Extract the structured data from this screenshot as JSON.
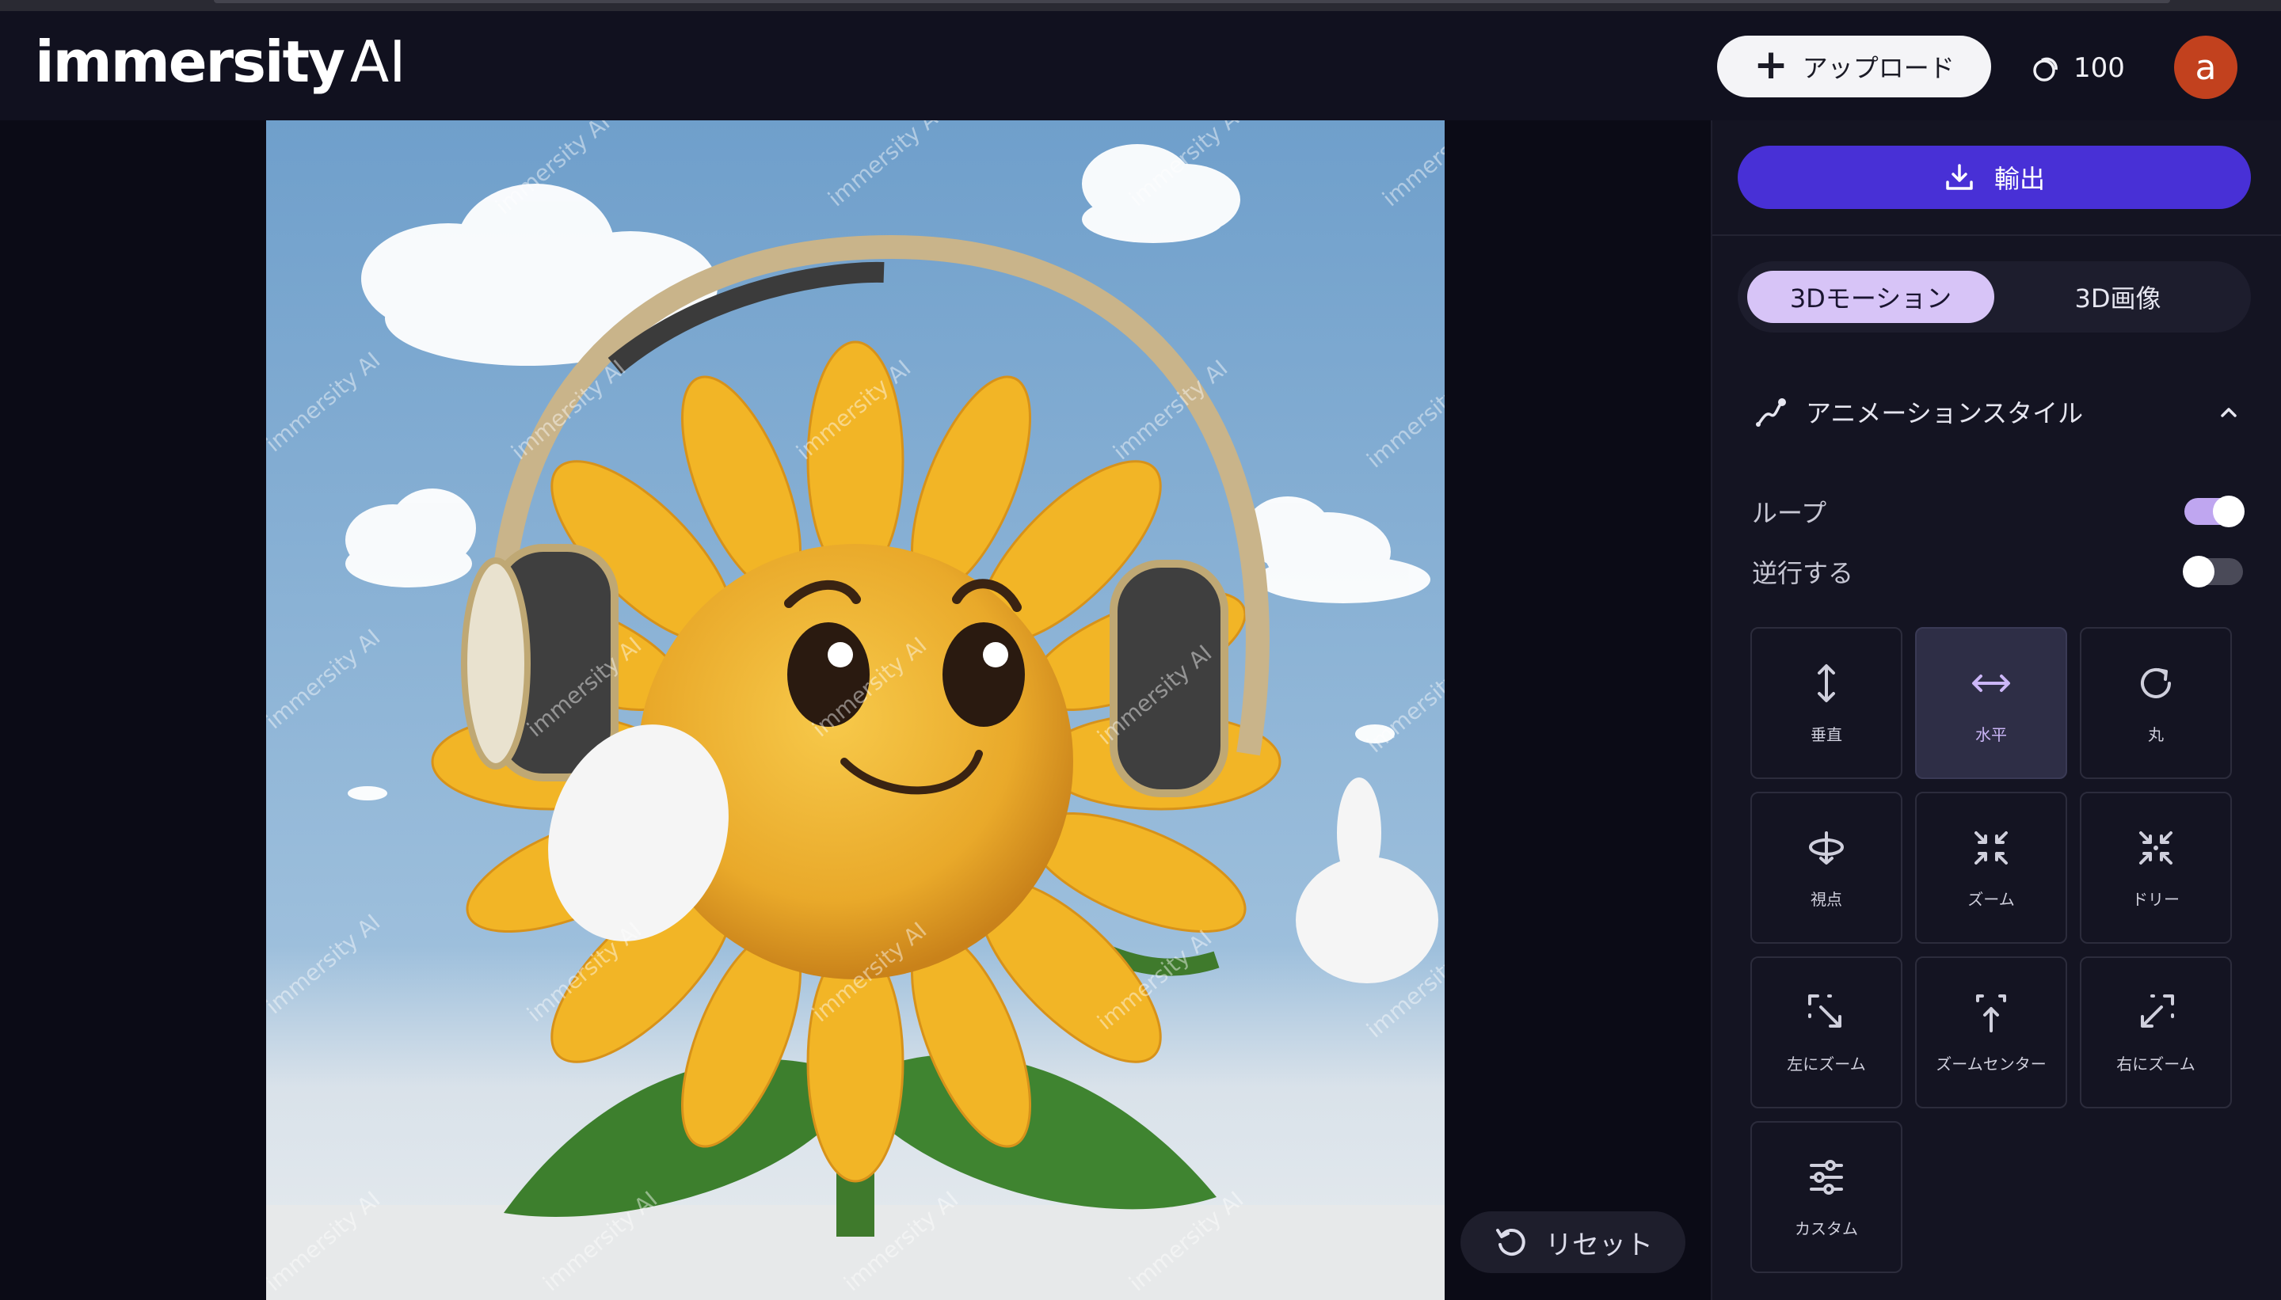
{
  "header": {
    "logo_main": "immersity",
    "logo_suffix": "AI",
    "upload_label": "アップロード",
    "credits": "100",
    "avatar_letter": "a"
  },
  "canvas": {
    "watermark": "immersity AI",
    "reset_label": "リセット"
  },
  "sidebar": {
    "export_label": "輸出",
    "tabs": [
      {
        "label": "3Dモーション",
        "active": true
      },
      {
        "label": "3D画像",
        "active": false
      }
    ],
    "section_title": "アニメーションスタイル",
    "toggles": [
      {
        "label": "ループ",
        "on": true
      },
      {
        "label": "逆行する",
        "on": false
      }
    ],
    "motions": [
      {
        "label": "垂直",
        "icon": "vertical-arrows-icon"
      },
      {
        "label": "水平",
        "icon": "horizontal-arrows-icon",
        "active": true
      },
      {
        "label": "丸",
        "icon": "circle-arrow-icon"
      },
      {
        "label": "視点",
        "icon": "orbit-icon"
      },
      {
        "label": "ズーム",
        "icon": "zoom-in-icon"
      },
      {
        "label": "ドリー",
        "icon": "dolly-icon"
      },
      {
        "label": "左にズーム",
        "icon": "zoom-left-icon"
      },
      {
        "label": "ズームセンター",
        "icon": "zoom-center-icon"
      },
      {
        "label": "右にズーム",
        "icon": "zoom-right-icon"
      },
      {
        "label": "カスタム",
        "icon": "sliders-icon"
      }
    ]
  },
  "colors": {
    "accent": "#4830d6",
    "tab_active": "#d7c4f7",
    "avatar": "#c2411e"
  }
}
